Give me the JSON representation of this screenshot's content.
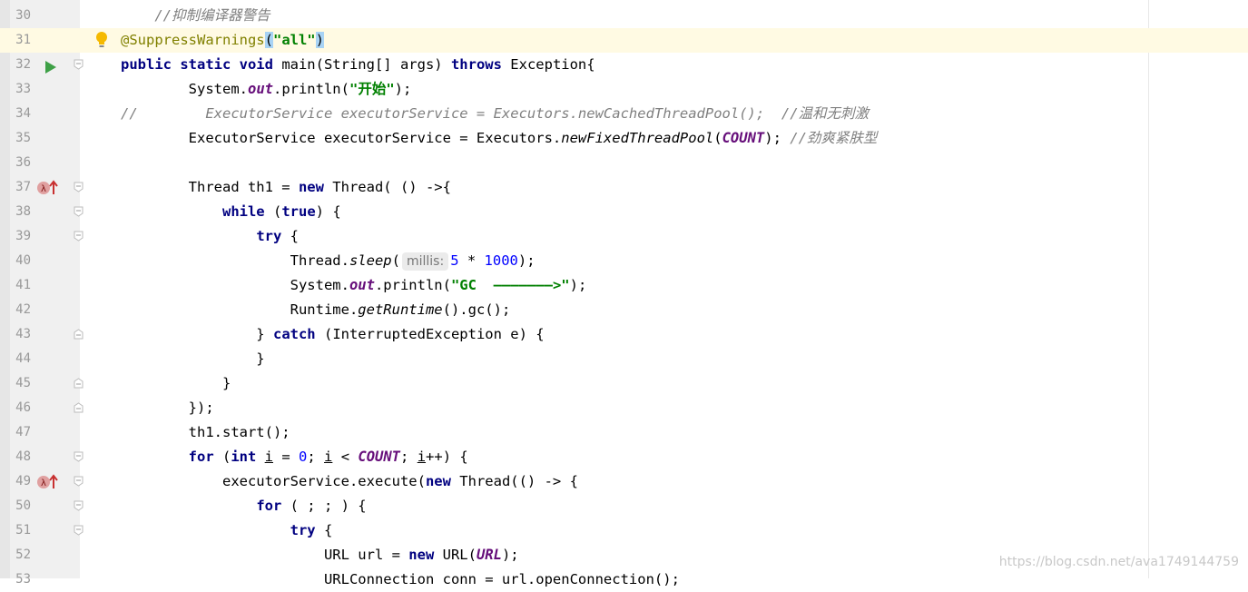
{
  "watermark": "https://blog.csdn.net/ava1749144759",
  "lines": [
    {
      "n": "30",
      "parts": [
        [
          "cmt",
          "    //抑制编译器警告"
        ]
      ]
    },
    {
      "n": "31",
      "parts": [
        [
          "ann",
          "@SuppressWarnings"
        ],
        [
          "hl",
          "("
        ],
        [
          "str",
          "\"all\""
        ],
        [
          "hl",
          ")"
        ]
      ]
    },
    {
      "n": "32",
      "parts": [
        [
          "kw",
          "public static void "
        ],
        [
          "",
          "main(String[] args) "
        ],
        [
          "kw",
          "throws "
        ],
        [
          "",
          "Exception{"
        ]
      ]
    },
    {
      "n": "33",
      "parts": [
        [
          "",
          "        System."
        ],
        [
          "field",
          "out"
        ],
        [
          "",
          ".println("
        ],
        [
          "str",
          "\"开始\""
        ],
        [
          "",
          ");"
        ]
      ]
    },
    {
      "n": "34",
      "parts": [
        [
          "cmt",
          "//        ExecutorService executorService = Executors.newCachedThreadPool();  //温和无刺激"
        ]
      ]
    },
    {
      "n": "35",
      "parts": [
        [
          "",
          "        ExecutorService executorService = Executors."
        ],
        [
          "stat",
          "newFixedThreadPool"
        ],
        [
          "",
          "("
        ],
        [
          "field",
          "COUNT"
        ],
        [
          "",
          ");"
        ],
        [
          "cmt",
          " //劲爽紧肤型"
        ]
      ]
    },
    {
      "n": "36",
      "parts": [
        [
          "",
          ""
        ]
      ]
    },
    {
      "n": "37",
      "parts": [
        [
          "",
          "        Thread th1 = "
        ],
        [
          "kw",
          "new "
        ],
        [
          "",
          "Thread( () ->{"
        ]
      ]
    },
    {
      "n": "38",
      "parts": [
        [
          "",
          "            "
        ],
        [
          "kw",
          "while "
        ],
        [
          "",
          "("
        ],
        [
          "kw",
          "true"
        ],
        [
          "",
          ") {"
        ]
      ]
    },
    {
      "n": "39",
      "parts": [
        [
          "",
          "                "
        ],
        [
          "kw",
          "try "
        ],
        [
          "",
          "{"
        ]
      ]
    },
    {
      "n": "40",
      "parts": [
        [
          "",
          "                    Thread."
        ],
        [
          "stat",
          "sleep"
        ],
        [
          "",
          "("
        ],
        [
          "hint",
          "millis:"
        ],
        [
          "num",
          "5 "
        ],
        [
          "",
          "* "
        ],
        [
          "num",
          "1000"
        ],
        [
          "",
          ");"
        ]
      ]
    },
    {
      "n": "41",
      "parts": [
        [
          "",
          "                    System."
        ],
        [
          "field",
          "out"
        ],
        [
          "",
          ".println("
        ],
        [
          "str",
          "\"GC  ———————>\""
        ],
        [
          "",
          ");"
        ]
      ]
    },
    {
      "n": "42",
      "parts": [
        [
          "",
          "                    Runtime."
        ],
        [
          "stat",
          "getRuntime"
        ],
        [
          "",
          "().gc();"
        ]
      ]
    },
    {
      "n": "43",
      "parts": [
        [
          "",
          "                } "
        ],
        [
          "kw",
          "catch "
        ],
        [
          "",
          "(InterruptedException e) {"
        ]
      ]
    },
    {
      "n": "44",
      "parts": [
        [
          "",
          "                }"
        ]
      ]
    },
    {
      "n": "45",
      "parts": [
        [
          "",
          "            }"
        ]
      ]
    },
    {
      "n": "46",
      "parts": [
        [
          "",
          "        });"
        ]
      ]
    },
    {
      "n": "47",
      "parts": [
        [
          "",
          "        th1.start();"
        ]
      ]
    },
    {
      "n": "48",
      "parts": [
        [
          "",
          "        "
        ],
        [
          "kw",
          "for "
        ],
        [
          "",
          "("
        ],
        [
          "kw",
          "int "
        ],
        [
          "u",
          "i"
        ],
        [
          "",
          " = "
        ],
        [
          "num",
          "0"
        ],
        [
          "",
          "; "
        ],
        [
          "u",
          "i"
        ],
        [
          "",
          " < "
        ],
        [
          "field",
          "COUNT"
        ],
        [
          "",
          "; "
        ],
        [
          "u",
          "i"
        ],
        [
          "",
          "++) {"
        ]
      ]
    },
    {
      "n": "49",
      "parts": [
        [
          "",
          "            executorService.execute("
        ],
        [
          "kw",
          "new "
        ],
        [
          "",
          "Thread(() -> {"
        ]
      ]
    },
    {
      "n": "50",
      "parts": [
        [
          "",
          "                "
        ],
        [
          "kw",
          "for "
        ],
        [
          "",
          "( ; ; ) {"
        ]
      ]
    },
    {
      "n": "51",
      "parts": [
        [
          "",
          "                    "
        ],
        [
          "kw",
          "try "
        ],
        [
          "",
          "{"
        ]
      ]
    },
    {
      "n": "52",
      "parts": [
        [
          "",
          "                        URL url = "
        ],
        [
          "kw",
          "new "
        ],
        [
          "",
          "URL("
        ],
        [
          "field",
          "URL"
        ],
        [
          "",
          ");"
        ]
      ]
    },
    {
      "n": "53",
      "parts": [
        [
          "",
          "                        URLConnection conn = url.openConnection();"
        ]
      ]
    }
  ]
}
